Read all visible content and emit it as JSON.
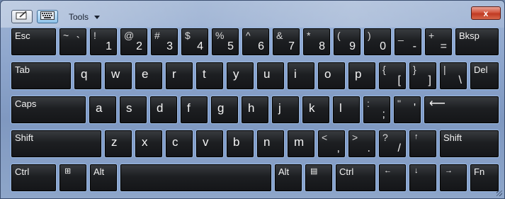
{
  "toolbar": {
    "tools_label": "Tools",
    "close_label": "x"
  },
  "keyboard": {
    "row1": [
      {
        "label": "Esc"
      },
      {
        "top": "~",
        "bottom": "`"
      },
      {
        "top": "!",
        "bottom": "1"
      },
      {
        "top": "@",
        "bottom": "2"
      },
      {
        "top": "#",
        "bottom": "3"
      },
      {
        "top": "$",
        "bottom": "4"
      },
      {
        "top": "%",
        "bottom": "5"
      },
      {
        "top": "^",
        "bottom": "6"
      },
      {
        "top": "&",
        "bottom": "7"
      },
      {
        "top": "*",
        "bottom": "8"
      },
      {
        "top": "(",
        "bottom": "9"
      },
      {
        "top": ")",
        "bottom": "0"
      },
      {
        "top": "_",
        "bottom": "-"
      },
      {
        "top": "+",
        "bottom": "="
      },
      {
        "label": "Bksp"
      }
    ],
    "row2": [
      {
        "label": "Tab"
      },
      {
        "letter": "q"
      },
      {
        "letter": "w"
      },
      {
        "letter": "e"
      },
      {
        "letter": "r"
      },
      {
        "letter": "t"
      },
      {
        "letter": "y"
      },
      {
        "letter": "u"
      },
      {
        "letter": "i"
      },
      {
        "letter": "o"
      },
      {
        "letter": "p"
      },
      {
        "top": "{",
        "bottom": "["
      },
      {
        "top": "}",
        "bottom": "]"
      },
      {
        "top": "|",
        "bottom": "\\"
      },
      {
        "label": "Del"
      }
    ],
    "row3": [
      {
        "label": "Caps"
      },
      {
        "letter": "a"
      },
      {
        "letter": "s"
      },
      {
        "letter": "d"
      },
      {
        "letter": "f"
      },
      {
        "letter": "g"
      },
      {
        "letter": "h"
      },
      {
        "letter": "j"
      },
      {
        "letter": "k"
      },
      {
        "letter": "l"
      },
      {
        "top": ":",
        "bottom": ";"
      },
      {
        "top": "\"",
        "bottom": "'"
      },
      {
        "icon": "enter-arrow-icon",
        "glyph": "⟵"
      }
    ],
    "row4": [
      {
        "label": "Shift"
      },
      {
        "letter": "z"
      },
      {
        "letter": "x"
      },
      {
        "letter": "c"
      },
      {
        "letter": "v"
      },
      {
        "letter": "b"
      },
      {
        "letter": "n"
      },
      {
        "letter": "m"
      },
      {
        "top": "<",
        "bottom": ","
      },
      {
        "top": ">",
        "bottom": "."
      },
      {
        "top": "?",
        "bottom": "/"
      },
      {
        "icon": "arrow-up-icon",
        "glyph": "↑"
      },
      {
        "label": "Shift"
      }
    ],
    "row5": [
      {
        "label": "Ctrl"
      },
      {
        "icon": "windows-logo-icon",
        "glyph": "⊞"
      },
      {
        "label": "Alt"
      },
      {
        "label": ""
      },
      {
        "label": "Alt"
      },
      {
        "icon": "context-menu-icon",
        "glyph": "▤"
      },
      {
        "label": "Ctrl"
      },
      {
        "icon": "arrow-left-icon",
        "glyph": "←"
      },
      {
        "icon": "arrow-down-icon",
        "glyph": "↓"
      },
      {
        "icon": "arrow-right-icon",
        "glyph": "→"
      },
      {
        "label": "Fn"
      }
    ]
  }
}
